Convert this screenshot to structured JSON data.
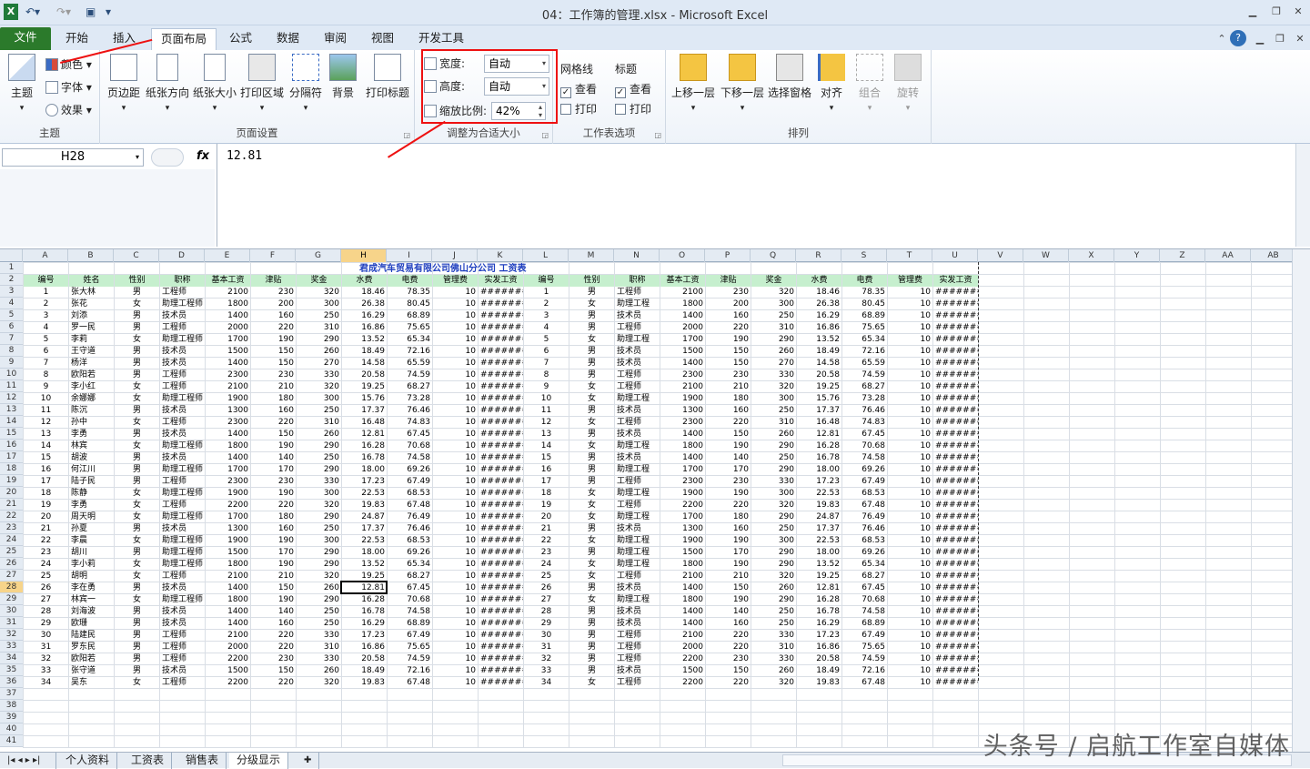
{
  "window": {
    "title": "04：工作簿的管理.xlsx - Microsoft Excel"
  },
  "tabs": [
    {
      "label": "文件"
    },
    {
      "label": "开始"
    },
    {
      "label": "插入"
    },
    {
      "label": "页面布局"
    },
    {
      "label": "公式"
    },
    {
      "label": "数据"
    },
    {
      "label": "审阅"
    },
    {
      "label": "视图"
    },
    {
      "label": "开发工具"
    }
  ],
  "ribbon": {
    "theme": {
      "main": "主题",
      "colors": "颜色",
      "fonts": "字体",
      "effects": "效果",
      "group": "主题"
    },
    "page_setup": {
      "margins": "页边距",
      "orientation": "纸张方向",
      "size": "纸张大小",
      "print_area": "打印区域",
      "breaks": "分隔符",
      "background": "背景",
      "print_titles": "打印标题",
      "group": "页面设置"
    },
    "scale": {
      "width_label": "宽度:",
      "width_value": "自动",
      "height_label": "高度:",
      "height_value": "自动",
      "scale_label": "缩放比例:",
      "scale_value": "42%",
      "group": "调整为合适大小"
    },
    "sheet_options": {
      "gridlines": "网格线",
      "headings": "标题",
      "view": "查看",
      "print": "打印",
      "group": "工作表选项"
    },
    "arrange": {
      "bring_forward": "上移一层",
      "send_backward": "下移一层",
      "selection_pane": "选择窗格",
      "align": "对齐",
      "group_btn": "组合",
      "rotate": "旋转",
      "group": "排列"
    }
  },
  "formula_bar": {
    "name_box": "H28",
    "fx": "fx",
    "value": "12.81"
  },
  "columns": [
    "A",
    "B",
    "C",
    "D",
    "E",
    "F",
    "G",
    "H",
    "I",
    "J",
    "K",
    "L",
    "M",
    "N",
    "O",
    "P",
    "Q",
    "R",
    "S",
    "T",
    "U",
    "V",
    "W",
    "X",
    "Y",
    "Z",
    "AA",
    "AB"
  ],
  "sheet_title": "君成汽车贸易有限公司佛山分公司   工资表",
  "headers": [
    "编号",
    "姓名",
    "性别",
    "职称",
    "基本工资",
    "津贴",
    "奖金",
    "水费",
    "电费",
    "管理费",
    "实发工资"
  ],
  "headers2": [
    "编号",
    "性别",
    "职称",
    "基本工资",
    "津贴",
    "奖金",
    "水费",
    "电费",
    "管理费",
    "实发工资"
  ],
  "rows": [
    [
      "1",
      "张大林",
      "男",
      "工程师",
      "2100",
      "230",
      "320",
      "18.46",
      "78.35",
      "10",
      "#######"
    ],
    [
      "2",
      "张花",
      "女",
      "助理工程师",
      "1800",
      "200",
      "300",
      "26.38",
      "80.45",
      "10",
      "#######"
    ],
    [
      "3",
      "刘添",
      "男",
      "技术员",
      "1400",
      "160",
      "250",
      "16.29",
      "68.89",
      "10",
      "#######"
    ],
    [
      "4",
      "罗一民",
      "男",
      "工程师",
      "2000",
      "220",
      "310",
      "16.86",
      "75.65",
      "10",
      "#######"
    ],
    [
      "5",
      "李莉",
      "女",
      "助理工程师",
      "1700",
      "190",
      "290",
      "13.52",
      "65.34",
      "10",
      "#######"
    ],
    [
      "6",
      "王守道",
      "男",
      "技术员",
      "1500",
      "150",
      "260",
      "18.49",
      "72.16",
      "10",
      "#######"
    ],
    [
      "7",
      "杨洋",
      "男",
      "技术员",
      "1400",
      "150",
      "270",
      "14.58",
      "65.59",
      "10",
      "#######"
    ],
    [
      "8",
      "欧阳若",
      "男",
      "工程师",
      "2300",
      "230",
      "330",
      "20.58",
      "74.59",
      "10",
      "#######"
    ],
    [
      "9",
      "李小红",
      "女",
      "工程师",
      "2100",
      "210",
      "320",
      "19.25",
      "68.27",
      "10",
      "#######"
    ],
    [
      "10",
      "余娜娜",
      "女",
      "助理工程师",
      "1900",
      "180",
      "300",
      "15.76",
      "73.28",
      "10",
      "#######"
    ],
    [
      "11",
      "陈沉",
      "男",
      "技术员",
      "1300",
      "160",
      "250",
      "17.37",
      "76.46",
      "10",
      "#######"
    ],
    [
      "12",
      "孙中",
      "女",
      "工程师",
      "2300",
      "220",
      "310",
      "16.48",
      "74.83",
      "10",
      "#######"
    ],
    [
      "13",
      "李勇",
      "男",
      "技术员",
      "1400",
      "150",
      "260",
      "12.81",
      "67.45",
      "10",
      "#######"
    ],
    [
      "14",
      "林宾",
      "女",
      "助理工程师",
      "1800",
      "190",
      "290",
      "16.28",
      "70.68",
      "10",
      "#######"
    ],
    [
      "15",
      "胡波",
      "男",
      "技术员",
      "1400",
      "140",
      "250",
      "16.78",
      "74.58",
      "10",
      "#######"
    ],
    [
      "16",
      "何江川",
      "男",
      "助理工程师",
      "1700",
      "170",
      "290",
      "18.00",
      "69.26",
      "10",
      "#######"
    ],
    [
      "17",
      "陆子民",
      "男",
      "工程师",
      "2300",
      "230",
      "330",
      "17.23",
      "67.49",
      "10",
      "#######"
    ],
    [
      "18",
      "陈静",
      "女",
      "助理工程师",
      "1900",
      "190",
      "300",
      "22.53",
      "68.53",
      "10",
      "#######"
    ],
    [
      "19",
      "李勇",
      "女",
      "工程师",
      "2200",
      "220",
      "320",
      "19.83",
      "67.48",
      "10",
      "#######"
    ],
    [
      "20",
      "周天明",
      "女",
      "助理工程师",
      "1700",
      "180",
      "290",
      "24.87",
      "76.49",
      "10",
      "#######"
    ],
    [
      "21",
      "孙夏",
      "男",
      "技术员",
      "1300",
      "160",
      "250",
      "17.37",
      "76.46",
      "10",
      "#######"
    ],
    [
      "22",
      "李晨",
      "女",
      "助理工程师",
      "1900",
      "190",
      "300",
      "22.53",
      "68.53",
      "10",
      "#######"
    ],
    [
      "23",
      "胡川",
      "男",
      "助理工程师",
      "1500",
      "170",
      "290",
      "18.00",
      "69.26",
      "10",
      "#######"
    ],
    [
      "24",
      "李小莉",
      "女",
      "助理工程师",
      "1800",
      "190",
      "290",
      "13.52",
      "65.34",
      "10",
      "#######"
    ],
    [
      "25",
      "胡明",
      "女",
      "工程师",
      "2100",
      "210",
      "320",
      "19.25",
      "68.27",
      "10",
      "#######"
    ],
    [
      "26",
      "李在勇",
      "男",
      "技术员",
      "1400",
      "150",
      "260",
      "12.81",
      "67.45",
      "10",
      "#######"
    ],
    [
      "27",
      "林宾一",
      "女",
      "助理工程师",
      "1800",
      "190",
      "290",
      "16.28",
      "70.68",
      "10",
      "#######"
    ],
    [
      "28",
      "刘海波",
      "男",
      "技术员",
      "1400",
      "140",
      "250",
      "16.78",
      "74.58",
      "10",
      "#######"
    ],
    [
      "29",
      "欧珊",
      "男",
      "技术员",
      "1400",
      "160",
      "250",
      "16.29",
      "68.89",
      "10",
      "#######"
    ],
    [
      "30",
      "陆建民",
      "男",
      "工程师",
      "2100",
      "220",
      "330",
      "17.23",
      "67.49",
      "10",
      "#######"
    ],
    [
      "31",
      "罗东民",
      "男",
      "工程师",
      "2000",
      "220",
      "310",
      "16.86",
      "75.65",
      "10",
      "#######"
    ],
    [
      "32",
      "欧阳若",
      "男",
      "工程师",
      "2200",
      "230",
      "330",
      "20.58",
      "74.59",
      "10",
      "#######"
    ],
    [
      "33",
      "张守道",
      "男",
      "技术员",
      "1500",
      "150",
      "260",
      "18.49",
      "72.16",
      "10",
      "#######"
    ],
    [
      "34",
      "吴东",
      "女",
      "工程师",
      "2200",
      "220",
      "320",
      "19.83",
      "67.48",
      "10",
      "#######"
    ]
  ],
  "rows2_titles": [
    "工程师",
    "助理工程",
    "技术员",
    "工程师",
    "助理工程",
    "技术员",
    "技术员",
    "工程师",
    "工程师",
    "助理工程",
    "技术员",
    "工程师",
    "技术员",
    "助理工程",
    "技术员",
    "助理工程",
    "工程师",
    "助理工程",
    "工程师",
    "助理工程",
    "技术员",
    "助理工程",
    "助理工程",
    "助理工程",
    "工程师",
    "技术员",
    "助理工程",
    "技术员",
    "技术员",
    "工程师",
    "工程师",
    "工程师",
    "技术员",
    "工程师"
  ],
  "row_numbers": [
    "1",
    "2",
    "3",
    "4",
    "5",
    "6",
    "7",
    "8",
    "9",
    "10",
    "11",
    "12",
    "13",
    "14",
    "15",
    "16",
    "17",
    "18",
    "19",
    "20",
    "21",
    "22",
    "23",
    "24",
    "25",
    "26",
    "27",
    "28",
    "29",
    "30",
    "31",
    "32",
    "33",
    "34",
    "35",
    "36",
    "37",
    "38",
    "39",
    "40",
    "41"
  ],
  "sheet_tabs": [
    "个人资料",
    "工资表",
    "销售表",
    "分级显示"
  ],
  "watermark": "头条号 / 启航工作室自媒体"
}
